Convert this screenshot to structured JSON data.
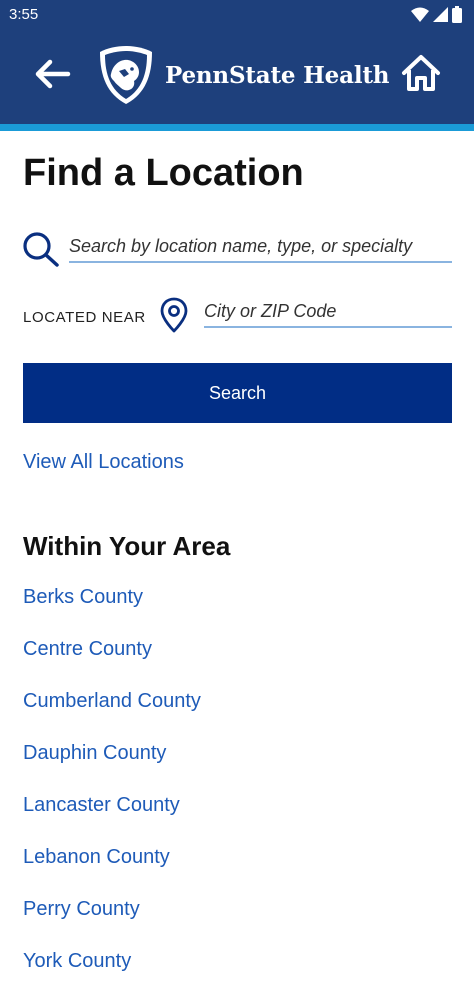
{
  "status_bar": {
    "time": "3:55",
    "icons": [
      "wifi-icon",
      "signal-icon",
      "battery-icon"
    ]
  },
  "header": {
    "brand": "PennState Health",
    "back_icon": "arrow-left-icon",
    "home_icon": "home-icon",
    "logo_icon": "nittany-lion-shield-icon"
  },
  "page": {
    "title": "Find a Location"
  },
  "search": {
    "placeholder": "Search by location name, type, or specialty",
    "value": ""
  },
  "near": {
    "label": "LOCATED NEAR",
    "placeholder": "City or ZIP Code",
    "value": ""
  },
  "search_button": {
    "label": "Search"
  },
  "view_all": {
    "label": "View All Locations"
  },
  "area": {
    "title": "Within Your Area",
    "counties": [
      "Berks County",
      "Centre County",
      "Cumberland County",
      "Dauphin County",
      "Lancaster County",
      "Lebanon County",
      "Perry County",
      "York County"
    ]
  },
  "colors": {
    "header_bg": "#1e407c",
    "stripe": "#1a9bd7",
    "button_bg": "#012d85",
    "link": "#1e5bb8"
  }
}
